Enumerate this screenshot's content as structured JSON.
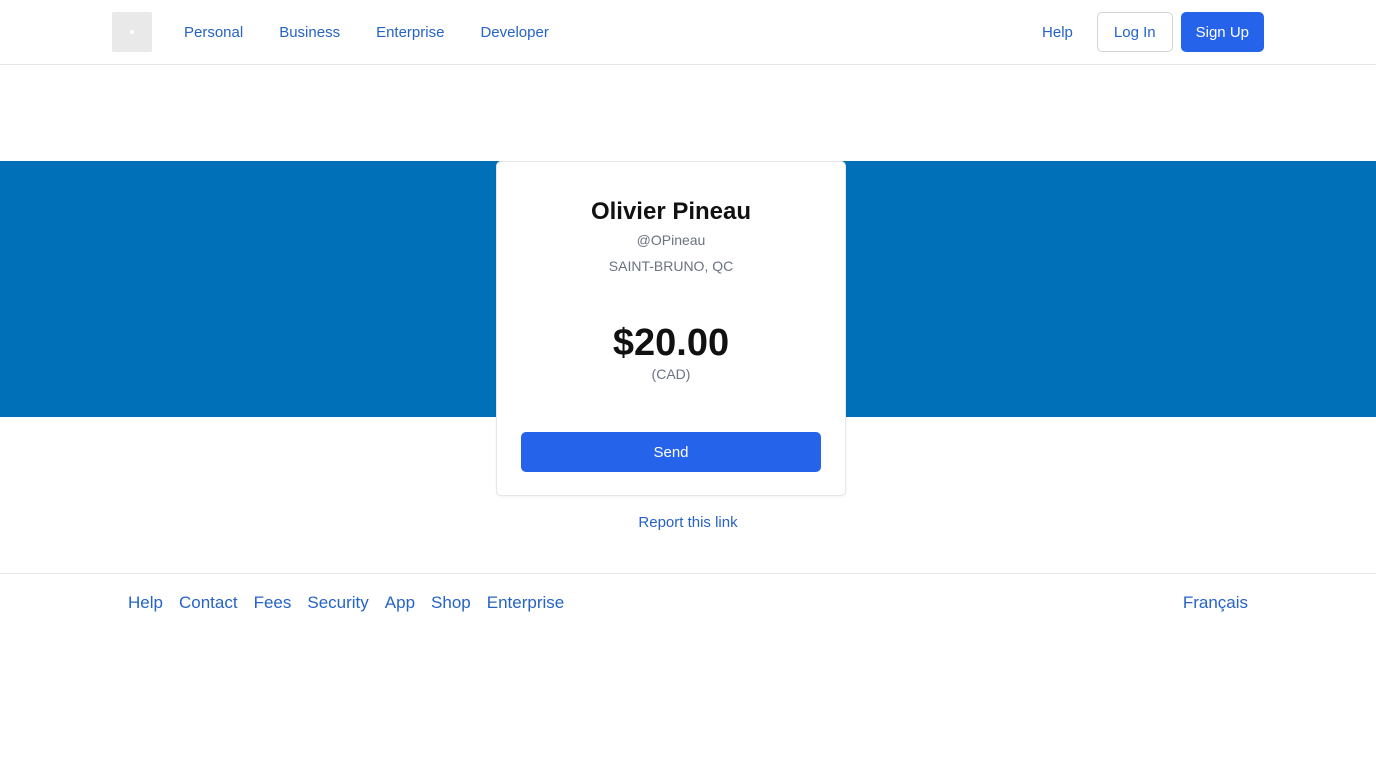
{
  "header": {
    "nav": [
      {
        "label": "Personal"
      },
      {
        "label": "Business"
      },
      {
        "label": "Enterprise"
      },
      {
        "label": "Developer"
      }
    ],
    "help_label": "Help",
    "login_label": "Log In",
    "signup_label": "Sign Up"
  },
  "card": {
    "name": "Olivier Pineau",
    "handle": "@OPineau",
    "location": "SAINT-BRUNO, QC",
    "amount": "$20.00",
    "currency": "(CAD)",
    "send_label": "Send"
  },
  "report_label": "Report this link",
  "footer": {
    "links": [
      {
        "label": "Help"
      },
      {
        "label": "Contact"
      },
      {
        "label": "Fees"
      },
      {
        "label": "Security"
      },
      {
        "label": "App"
      },
      {
        "label": "Shop"
      },
      {
        "label": "Enterprise"
      }
    ],
    "language_label": "Français"
  },
  "colors": {
    "brand_blue": "#0070b8",
    "button_blue": "#2563eb",
    "link_blue": "#2563c7"
  }
}
